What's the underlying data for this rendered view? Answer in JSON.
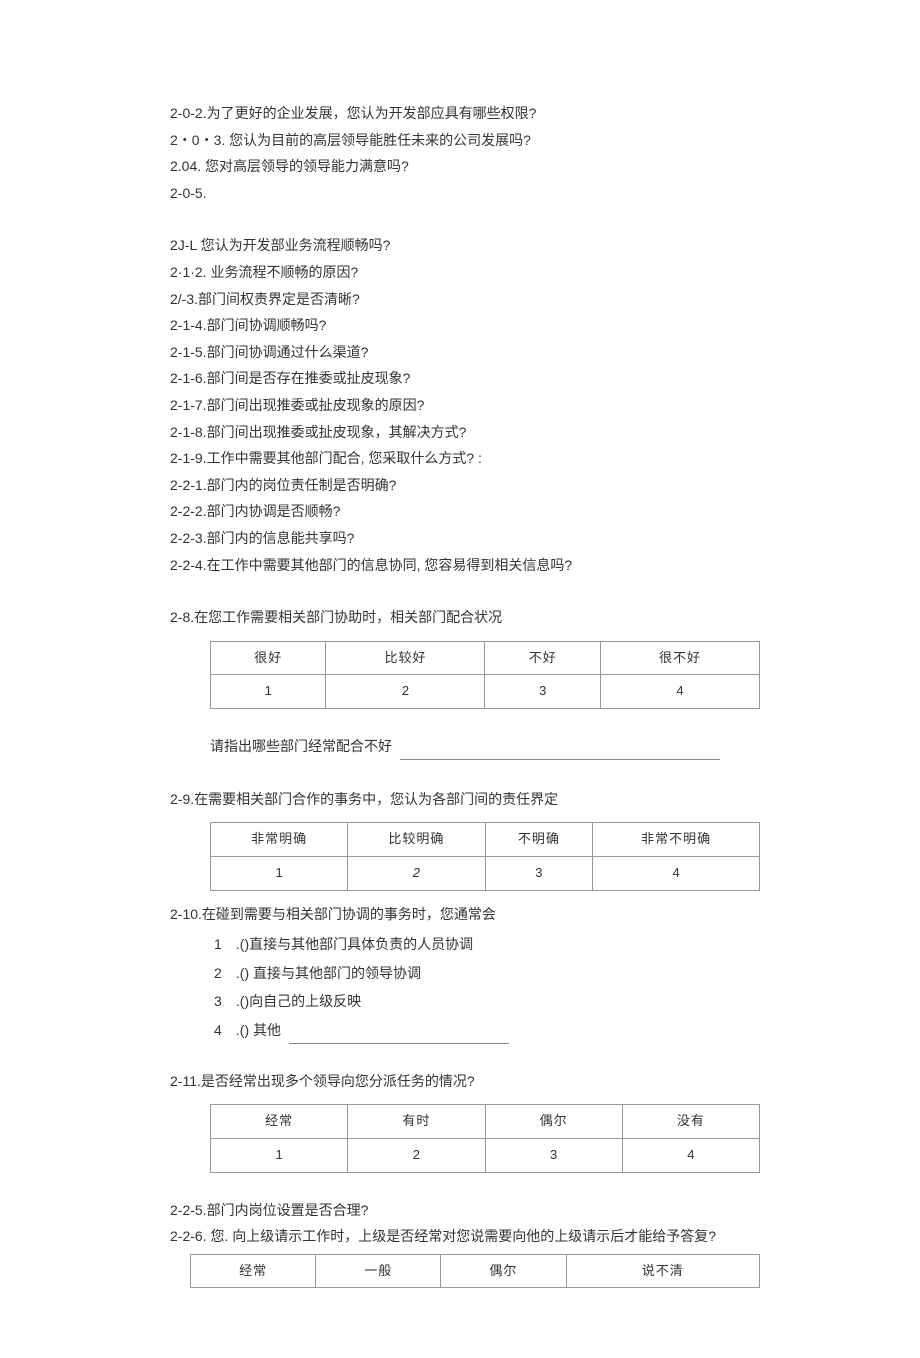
{
  "intro": {
    "l1": "2-0-2.为了更好的企业发展，您认为开发部应具有哪些权限?",
    "l2": "2・0・3. 您认为目前的高层领导能胜任未来的公司发展吗?",
    "l3": "2.04. 您对高层领导的领导能力满意吗?",
    "l4": "2-0-5."
  },
  "block1": {
    "b1": "2J-L 您认为开发部业务流程顺畅吗?",
    "b2": "2·1·2. 业务流程不顺畅的原因?",
    "b3": "2/-3.部门间权责界定是否清晰?",
    "b4": "2-1-4.部门间协调顺畅吗?",
    "b5": "2-1-5.部门间协调通过什么渠道?",
    "b6": "2-1-6.部门间是否存在推委或扯皮现象?",
    "b7": "2-1-7.部门间出现推委或扯皮现象的原因?",
    "b8": "2-1-8.部门间出现推委或扯皮现象，其解决方式?",
    "b9": "2-1-9.工作中需要其他部门配合, 您采取什么方式? :",
    "b10": "2-2-1.部门内的岗位责任制是否明确?",
    "b11": "2-2-2.部门内协调是否顺畅?",
    "b12": "2-2-3.部门内的信息能共享吗?",
    "b13": "2-2-4.在工作中需要其他部门的信息协同, 您容易得到相关信息吗?"
  },
  "q28": {
    "title": "2-8.在您工作需要相关部门协助时，相关部门配合状况",
    "headers": [
      "很好",
      "比较好",
      "不好",
      "很不好"
    ],
    "values": [
      "1",
      "2",
      "3",
      "4"
    ],
    "note": "请指出哪些部门经常配合不好"
  },
  "q29": {
    "title": "2-9.在需要相关部门合作的事务中，您认为各部门间的责任界定",
    "headers": [
      "非常明确",
      "比较明确",
      "不明确",
      "非常不明确"
    ],
    "values": [
      "1",
      "2",
      "3",
      "4"
    ]
  },
  "q210": {
    "title": "2-10.在碰到需要与相关部门协调的事务时，您通常会",
    "opts": [
      {
        "n": "1",
        "t": ".()直接与其他部门具体负责的人员协调"
      },
      {
        "n": "2",
        "t": ".() 直接与其他部门的领导协调"
      },
      {
        "n": "3",
        "t": ".()向自己的上级反映"
      },
      {
        "n": "4",
        "t": ".() 其他"
      }
    ]
  },
  "q211": {
    "title": "2-11.是否经常出现多个领导向您分派任务的情况?",
    "headers": [
      "经常",
      "有时",
      "偶尔",
      "没有"
    ],
    "values": [
      "1",
      "2",
      "3",
      "4"
    ]
  },
  "tail": {
    "t1": "2-2-5.部门内岗位设置是否合理?",
    "t2": "2-2-6. 您. 向上级请示工作时，上级是否经常对您说需要向他的上级请示后才能给予答复?",
    "headers": [
      "经常",
      "一般",
      "偶尔",
      "说不清"
    ]
  }
}
